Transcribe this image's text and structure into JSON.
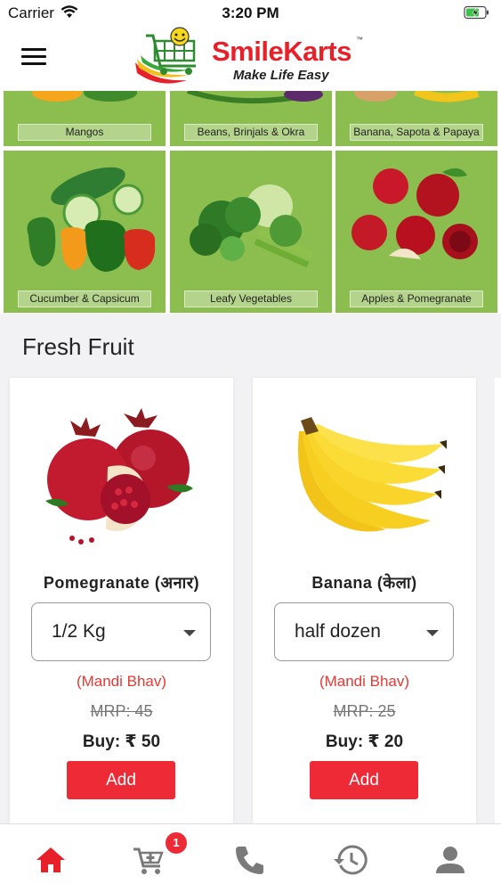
{
  "status_bar": {
    "carrier": "Carrier",
    "time": "3:20 PM"
  },
  "header": {
    "logo_name": "SmileKarts",
    "logo_tm": "™",
    "logo_tagline": "Make Life Easy"
  },
  "categories": [
    {
      "label": "Mangos"
    },
    {
      "label": "Beans, Brinjals & Okra"
    },
    {
      "label": "Banana, Sapota & Papaya"
    },
    {
      "label": "Cucumber & Capsicum"
    },
    {
      "label": "Leafy Vegetables"
    },
    {
      "label": "Apples & Pomegranate"
    }
  ],
  "section": {
    "title": "Fresh Fruit"
  },
  "products": [
    {
      "name": "Pomegranate (अनार)",
      "quantity": "1/2 Kg",
      "mandi": "(Mandi Bhav)",
      "mrp": "MRP: 45",
      "buy": "Buy: ₹ 50",
      "add_label": "Add"
    },
    {
      "name": "Banana (केला)",
      "quantity": "half dozen",
      "mandi": "(Mandi Bhav)",
      "mrp": "MRP: 25",
      "buy": "Buy: ₹ 20",
      "add_label": "Add"
    }
  ],
  "tab_bar": {
    "items": [
      {
        "icon": "home-icon",
        "active": true
      },
      {
        "icon": "cart-add-icon",
        "active": false
      },
      {
        "icon": "phone-icon",
        "active": false
      },
      {
        "icon": "history-icon",
        "active": false
      },
      {
        "icon": "account-icon",
        "active": false
      }
    ],
    "cart_badge": "1"
  },
  "colors": {
    "accent_red": "#ee2a36",
    "category_green": "#8cbd4f",
    "inactive_icon": "#7a7a7a"
  }
}
